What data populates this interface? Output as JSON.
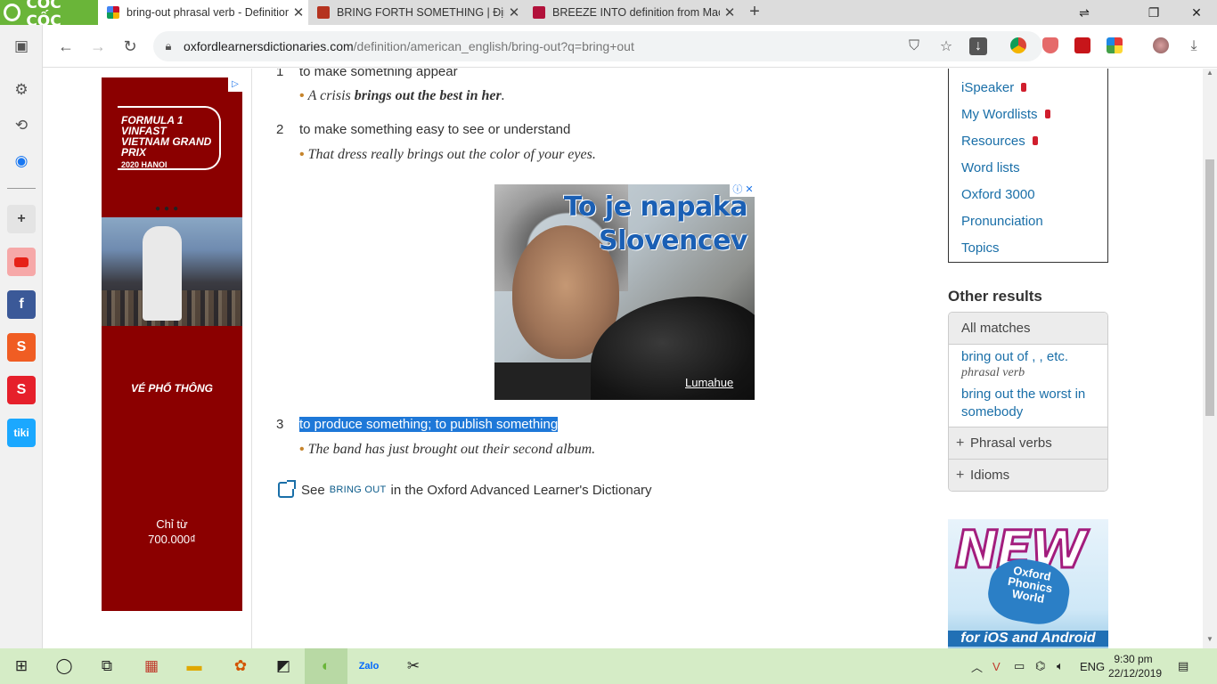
{
  "browser": {
    "brand_label": "CỐC CỐC",
    "tabs": [
      {
        "title": "bring-out phrasal verb - Definition",
        "active": true
      },
      {
        "title": "BRING FORTH SOMETHING | Định",
        "active": false
      },
      {
        "title": "BREEZE INTO definition from Macm",
        "active": false
      }
    ],
    "new_tab_icon": "+",
    "address": {
      "host": "oxfordlearnersdictionaries.com",
      "path": "/definition/american_english/bring-out?q=bring+out"
    }
  },
  "content": {
    "senses": [
      {
        "num": "1",
        "definition": "to make something appear"
      },
      {
        "num": "2",
        "definition": "to make something easy to see or understand"
      },
      {
        "num": "3",
        "definition": "to produce something; to publish something"
      }
    ],
    "examples": {
      "ex1_pre": "A crisis ",
      "ex1_bold": "brings out the best in her",
      "ex1_post": ".",
      "ex2": "That dress really brings out the color of your eyes.",
      "ex3": "The band has just brought out their second album."
    },
    "see": {
      "pre": "See",
      "link": "bring out",
      "post": "in the Oxford Advanced Learner's Dictionary"
    }
  },
  "ads": {
    "left": {
      "title": "FORMULA 1 VINFAST VIETNAM GRAND PRIX",
      "year": "2020 HANOI",
      "subtitle": "VÉ PHỔ THÔNG",
      "price_line1": "Chỉ từ",
      "price_line2": "700.000₫"
    },
    "middle": {
      "line1": "To je napaka",
      "line2": "Slovencev",
      "brand": "Lumahue"
    },
    "right": {
      "new": "NEW",
      "badge": "Oxford Phonics World",
      "platforms": "for iOS and Android"
    }
  },
  "sidebar_right": {
    "nav": [
      {
        "label": "iSpeaker",
        "locked": true
      },
      {
        "label": "My Wordlists",
        "locked": true
      },
      {
        "label": "Resources",
        "locked": true
      },
      {
        "label": "Word lists",
        "locked": false
      },
      {
        "label": "Oxford 3000",
        "locked": false
      },
      {
        "label": "Pronunciation",
        "locked": false
      },
      {
        "label": "Topics",
        "locked": false
      }
    ],
    "other_results_heading": "Other results",
    "all_matches_label": "All matches",
    "matches": [
      {
        "text": "bring out of , , etc.",
        "pos": "phrasal verb"
      },
      {
        "text": "bring out the worst in somebody",
        "pos": ""
      }
    ],
    "groups": [
      {
        "label": "Phrasal verbs"
      },
      {
        "label": "Idioms"
      }
    ]
  },
  "taskbar": {
    "lang": "ENG",
    "time": "9:30 pm",
    "date": "22/12/2019"
  },
  "colors": {
    "accent_green": "#6ab539",
    "link_blue": "#1a6fa8",
    "highlight_blue": "#1e78d8",
    "bullet_orange": "#c6842c",
    "ad_red": "#8b0000"
  }
}
